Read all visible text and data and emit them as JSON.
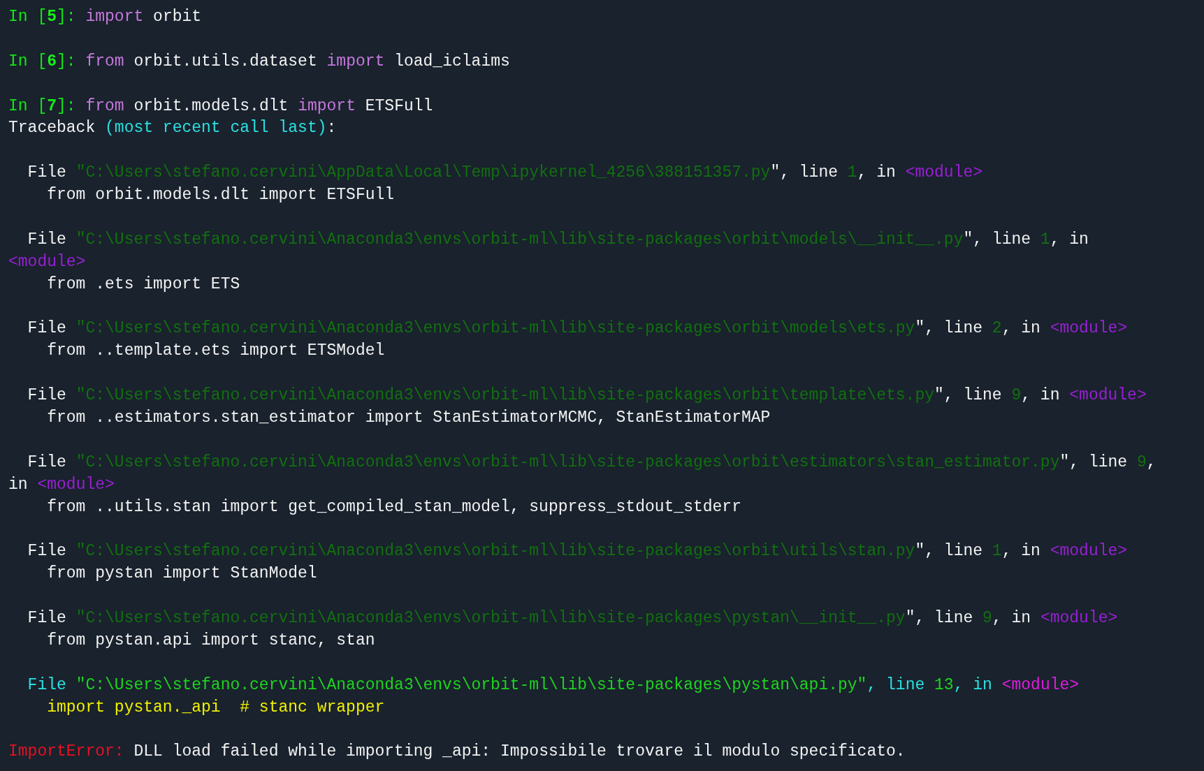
{
  "blocks": [
    {
      "lines": [
        [
          {
            "text": "In [",
            "kind": "prompt"
          },
          {
            "text": "5",
            "kind": "prompt_num"
          },
          {
            "text": "]: ",
            "kind": "prompt"
          },
          {
            "text": "import",
            "kind": "keyword"
          },
          {
            "text": " orbit",
            "kind": "plain"
          }
        ]
      ]
    },
    {
      "lines": [
        [
          {
            "text": "In [",
            "kind": "prompt"
          },
          {
            "text": "6",
            "kind": "prompt_num"
          },
          {
            "text": "]: ",
            "kind": "prompt"
          },
          {
            "text": "from",
            "kind": "keyword"
          },
          {
            "text": " orbit.utils.dataset ",
            "kind": "plain"
          },
          {
            "text": "import",
            "kind": "keyword"
          },
          {
            "text": " load_iclaims",
            "kind": "plain"
          }
        ]
      ]
    },
    {
      "lines": [
        [
          {
            "text": "In [",
            "kind": "prompt"
          },
          {
            "text": "7",
            "kind": "prompt_num"
          },
          {
            "text": "]: ",
            "kind": "prompt"
          },
          {
            "text": "from",
            "kind": "keyword"
          },
          {
            "text": " orbit.models.dlt ",
            "kind": "plain"
          },
          {
            "text": "import",
            "kind": "keyword"
          },
          {
            "text": " ETSFull",
            "kind": "plain"
          }
        ],
        [
          {
            "text": "Traceback ",
            "kind": "plain"
          },
          {
            "text": "(most recent call last)",
            "kind": "cyan"
          },
          {
            "text": ":",
            "kind": "plain"
          }
        ]
      ]
    },
    {
      "lines": [
        [
          {
            "text": "  File ",
            "kind": "plain"
          },
          {
            "text": "\"C:\\Users\\stefano.cervini\\AppData\\Local\\Temp\\ipykernel_4256\\388151357.py",
            "kind": "path"
          },
          {
            "text": "\", line ",
            "kind": "plain"
          },
          {
            "text": "1",
            "kind": "path"
          },
          {
            "text": ", in ",
            "kind": "plain"
          },
          {
            "text": "<module>",
            "kind": "module"
          }
        ],
        [
          {
            "text": "    from orbit.models.dlt import ETSFull",
            "kind": "plain"
          }
        ]
      ]
    },
    {
      "lines": [
        [
          {
            "text": "  File ",
            "kind": "plain"
          },
          {
            "text": "\"C:\\Users\\stefano.cervini\\Anaconda3\\envs\\orbit-ml\\lib\\site-packages\\orbit\\models\\__init__.py",
            "kind": "path"
          },
          {
            "text": "\", line ",
            "kind": "plain"
          },
          {
            "text": "1",
            "kind": "path"
          },
          {
            "text": ", in",
            "kind": "plain"
          }
        ],
        [
          {
            "text": "<module>",
            "kind": "module"
          }
        ],
        [
          {
            "text": "    from .ets import ETS",
            "kind": "plain"
          }
        ]
      ]
    },
    {
      "lines": [
        [
          {
            "text": "  File ",
            "kind": "plain"
          },
          {
            "text": "\"C:\\Users\\stefano.cervini\\Anaconda3\\envs\\orbit-ml\\lib\\site-packages\\orbit\\models\\ets.py",
            "kind": "path"
          },
          {
            "text": "\", line ",
            "kind": "plain"
          },
          {
            "text": "2",
            "kind": "path"
          },
          {
            "text": ", in ",
            "kind": "plain"
          },
          {
            "text": "<module>",
            "kind": "module"
          }
        ],
        [
          {
            "text": "    from ..template.ets import ETSModel",
            "kind": "plain"
          }
        ]
      ]
    },
    {
      "lines": [
        [
          {
            "text": "  File ",
            "kind": "plain"
          },
          {
            "text": "\"C:\\Users\\stefano.cervini\\Anaconda3\\envs\\orbit-ml\\lib\\site-packages\\orbit\\template\\ets.py",
            "kind": "path"
          },
          {
            "text": "\", line ",
            "kind": "plain"
          },
          {
            "text": "9",
            "kind": "path"
          },
          {
            "text": ", in ",
            "kind": "plain"
          },
          {
            "text": "<module>",
            "kind": "module"
          }
        ],
        [
          {
            "text": "    from ..estimators.stan_estimator import StanEstimatorMCMC, StanEstimatorMAP",
            "kind": "plain"
          }
        ]
      ]
    },
    {
      "lines": [
        [
          {
            "text": "  File ",
            "kind": "plain"
          },
          {
            "text": "\"C:\\Users\\stefano.cervini\\Anaconda3\\envs\\orbit-ml\\lib\\site-packages\\orbit\\estimators\\stan_estimator.py",
            "kind": "path"
          },
          {
            "text": "\", line ",
            "kind": "plain"
          },
          {
            "text": "9",
            "kind": "path"
          },
          {
            "text": ",",
            "kind": "plain"
          }
        ],
        [
          {
            "text": "in ",
            "kind": "plain"
          },
          {
            "text": "<module>",
            "kind": "module"
          }
        ],
        [
          {
            "text": "    from ..utils.stan import get_compiled_stan_model, suppress_stdout_stderr",
            "kind": "plain"
          }
        ]
      ]
    },
    {
      "lines": [
        [
          {
            "text": "  File ",
            "kind": "plain"
          },
          {
            "text": "\"C:\\Users\\stefano.cervini\\Anaconda3\\envs\\orbit-ml\\lib\\site-packages\\orbit\\utils\\stan.py",
            "kind": "path"
          },
          {
            "text": "\", line ",
            "kind": "plain"
          },
          {
            "text": "1",
            "kind": "path"
          },
          {
            "text": ", in ",
            "kind": "plain"
          },
          {
            "text": "<module>",
            "kind": "module"
          }
        ],
        [
          {
            "text": "    from pystan import StanModel",
            "kind": "plain"
          }
        ]
      ]
    },
    {
      "lines": [
        [
          {
            "text": "  File ",
            "kind": "plain"
          },
          {
            "text": "\"C:\\Users\\stefano.cervini\\Anaconda3\\envs\\orbit-ml\\lib\\site-packages\\pystan\\__init__.py",
            "kind": "path"
          },
          {
            "text": "\", line ",
            "kind": "plain"
          },
          {
            "text": "9",
            "kind": "path"
          },
          {
            "text": ", in ",
            "kind": "plain"
          },
          {
            "text": "<module>",
            "kind": "module"
          }
        ],
        [
          {
            "text": "    from pystan.api import stanc, stan",
            "kind": "plain"
          }
        ]
      ]
    },
    {
      "lines": [
        [
          {
            "text": "  File ",
            "kind": "cyan"
          },
          {
            "text": "\"C:\\Users\\stefano.cervini\\Anaconda3\\envs\\orbit-ml\\lib\\site-packages\\pystan\\api.py",
            "kind": "path_hi"
          },
          {
            "text": "\"",
            "kind": "path_hi"
          },
          {
            "text": ", line ",
            "kind": "cyan"
          },
          {
            "text": "13",
            "kind": "path_hi"
          },
          {
            "text": ", in ",
            "kind": "cyan"
          },
          {
            "text": "<module>",
            "kind": "module_hi"
          }
        ],
        [
          {
            "text": "    import pystan._api  # stanc wrapper",
            "kind": "code_hi"
          }
        ]
      ]
    },
    {
      "lines": [
        [
          {
            "text": "ImportError:",
            "kind": "error"
          },
          {
            "text": " DLL load failed while importing _api: Impossibile trovare il modulo specificato.",
            "kind": "plain"
          }
        ]
      ]
    }
  ]
}
